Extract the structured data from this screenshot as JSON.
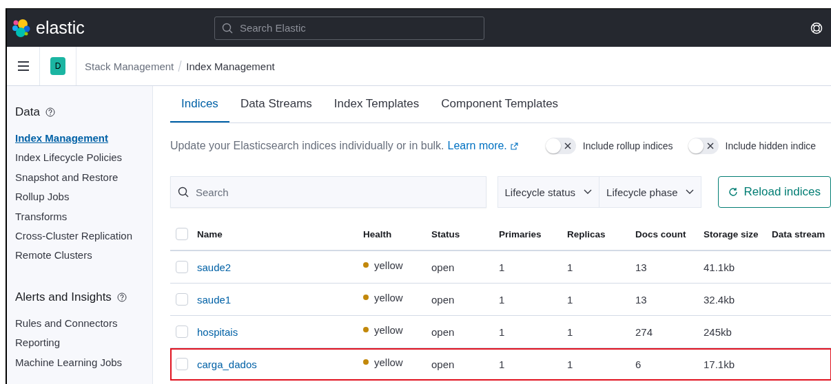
{
  "header": {
    "brand": "elastic",
    "search": {
      "placeholder": "Search Elastic"
    }
  },
  "breadcrumbs": {
    "space": "D",
    "items": [
      {
        "label": "Stack Management",
        "current": false
      },
      {
        "label": "Index Management",
        "current": true
      }
    ]
  },
  "sidebar": {
    "sections": [
      {
        "title": "Data",
        "items": [
          {
            "label": "Index Management",
            "selected": true
          },
          {
            "label": "Index Lifecycle Policies",
            "selected": false
          },
          {
            "label": "Snapshot and Restore",
            "selected": false
          },
          {
            "label": "Rollup Jobs",
            "selected": false
          },
          {
            "label": "Transforms",
            "selected": false
          },
          {
            "label": "Cross-Cluster Replication",
            "selected": false
          },
          {
            "label": "Remote Clusters",
            "selected": false
          }
        ]
      },
      {
        "title": "Alerts and Insights",
        "items": [
          {
            "label": "Rules and Connectors",
            "selected": false
          },
          {
            "label": "Reporting",
            "selected": false
          },
          {
            "label": "Machine Learning Jobs",
            "selected": false
          }
        ]
      }
    ]
  },
  "tabs": [
    {
      "label": "Indices",
      "selected": true
    },
    {
      "label": "Data Streams",
      "selected": false
    },
    {
      "label": "Index Templates",
      "selected": false
    },
    {
      "label": "Component Templates",
      "selected": false
    }
  ],
  "description": {
    "text": "Update your Elasticsearch indices individually or in bulk.",
    "link": "Learn more."
  },
  "switches": [
    {
      "label": "Include rollup indices",
      "on": false
    },
    {
      "label": "Include hidden indice",
      "on": false
    }
  ],
  "search": {
    "placeholder": "Search"
  },
  "filters": [
    "Lifecycle status",
    "Lifecycle phase"
  ],
  "reload_button": "Reload indices",
  "table": {
    "select_all_checked": false,
    "columns": [
      "Name",
      "Health",
      "Status",
      "Primaries",
      "Replicas",
      "Docs count",
      "Storage size",
      "Data stream"
    ],
    "rows": [
      {
        "name": "saude2",
        "health": "yellow",
        "color": "#c2880b",
        "status": "open",
        "primaries": "1",
        "replicas": "1",
        "docs_count": "13",
        "storage_size": "41.1kb",
        "checked": false,
        "highlighted": false
      },
      {
        "name": "saude1",
        "health": "yellow",
        "color": "#c2880b",
        "status": "open",
        "primaries": "1",
        "replicas": "1",
        "docs_count": "13",
        "storage_size": "32.4kb",
        "checked": false,
        "highlighted": false
      },
      {
        "name": "hospitais",
        "health": "yellow",
        "color": "#c2880b",
        "status": "open",
        "primaries": "1",
        "replicas": "1",
        "docs_count": "274",
        "storage_size": "245kb",
        "checked": false,
        "highlighted": false
      },
      {
        "name": "carga_dados",
        "health": "yellow",
        "color": "#c2880b",
        "status": "open",
        "primaries": "1",
        "replicas": "1",
        "docs_count": "6",
        "storage_size": "17.1kb",
        "checked": false,
        "highlighted": true
      }
    ]
  }
}
